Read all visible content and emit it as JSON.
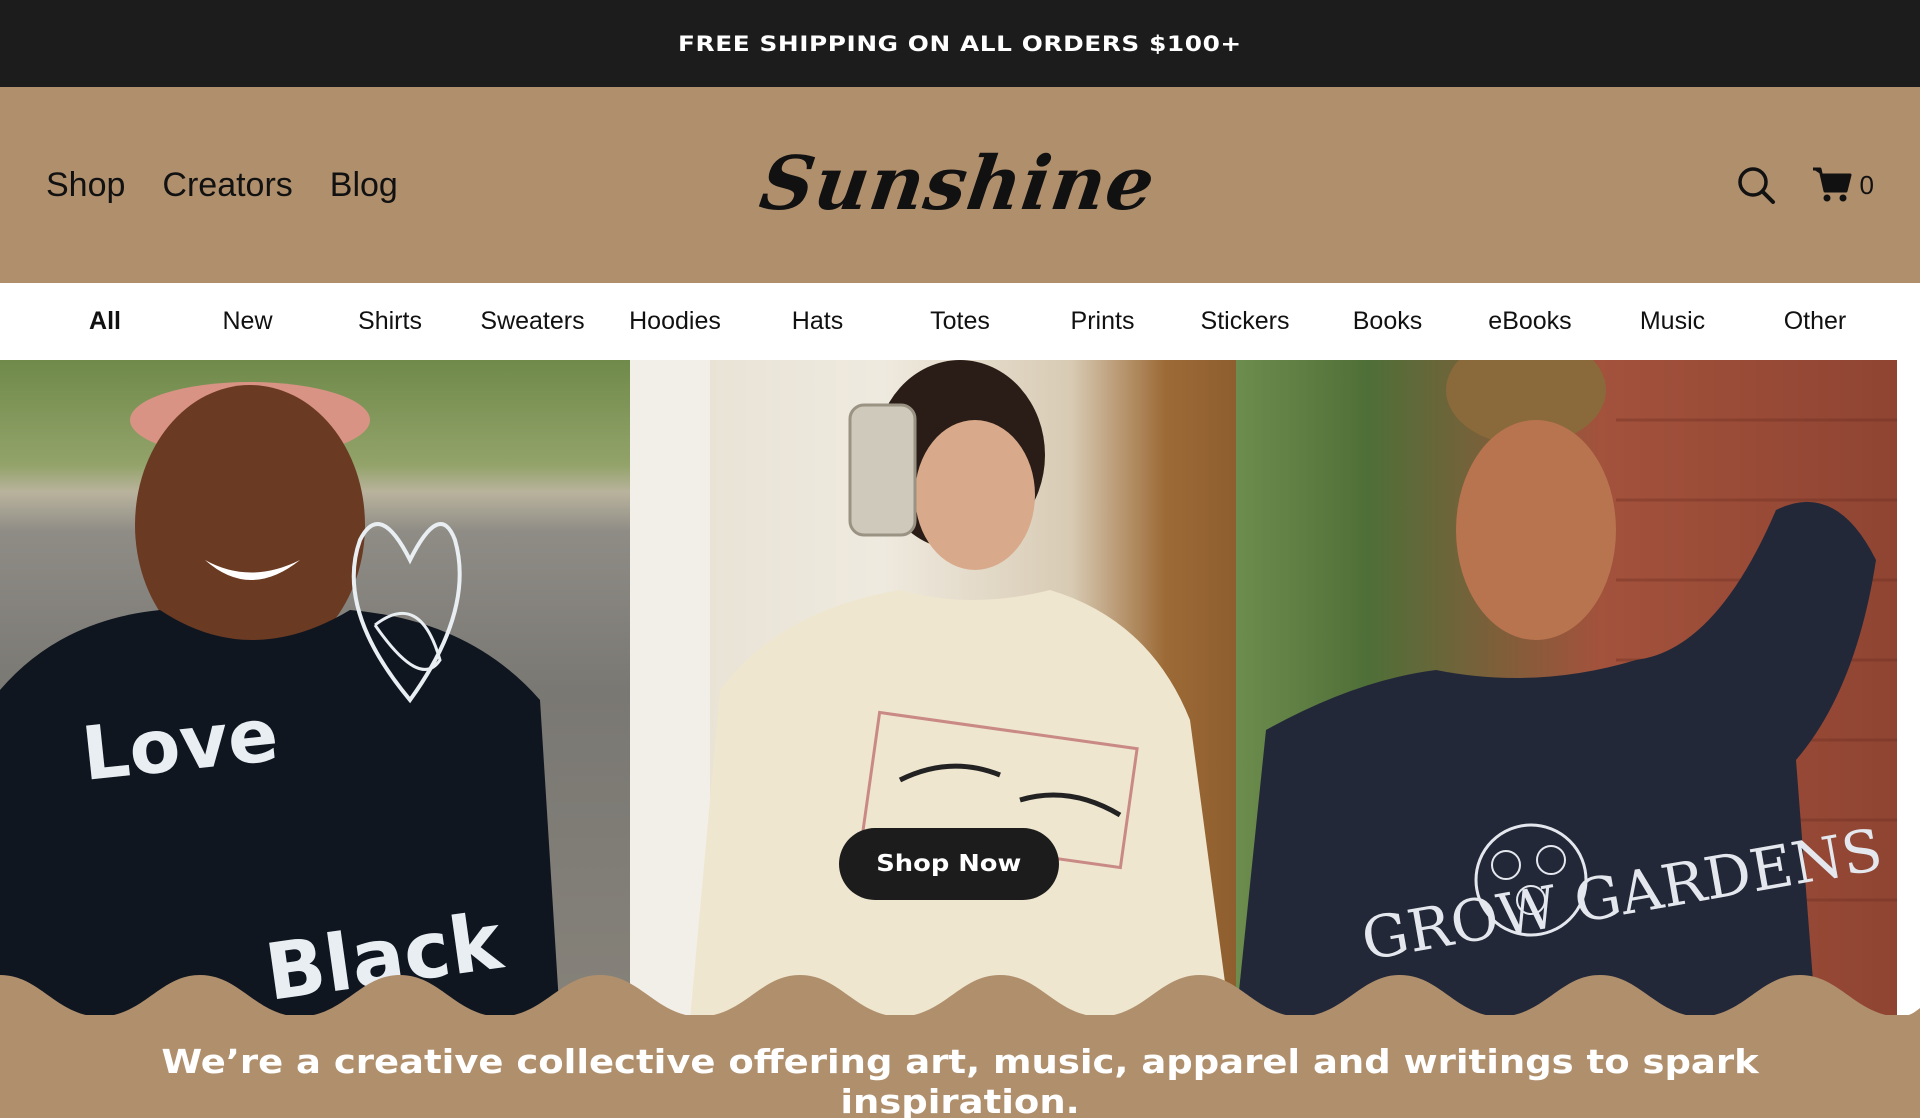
{
  "announcement": {
    "text": "FREE SHIPPING ON ALL ORDERS $100+"
  },
  "header": {
    "nav": [
      {
        "label": "Shop"
      },
      {
        "label": "Creators"
      },
      {
        "label": "Blog"
      }
    ],
    "logo_text": "Sunshine",
    "cart_count": "0"
  },
  "categories": [
    {
      "label": "All",
      "active": true
    },
    {
      "label": "New"
    },
    {
      "label": "Shirts"
    },
    {
      "label": "Sweaters"
    },
    {
      "label": "Hoodies"
    },
    {
      "label": "Hats"
    },
    {
      "label": "Totes"
    },
    {
      "label": "Prints"
    },
    {
      "label": "Stickers"
    },
    {
      "label": "Books"
    },
    {
      "label": "eBooks"
    },
    {
      "label": "Music"
    },
    {
      "label": "Other"
    }
  ],
  "hero": {
    "cta_label": "Shop Now",
    "shirt_text_1": "Love",
    "shirt_text_2": "Black",
    "shirt_text_3": "GROW GARDENS"
  },
  "tagline": "We’re a creative collective offering art, music, apparel and writings to spark inspiration.",
  "colors": {
    "announce_bg": "#1c1c1c",
    "header_bg": "#b08f6d",
    "button_bg": "#1c1c1c"
  },
  "icons": [
    "search-icon",
    "cart-icon"
  ]
}
